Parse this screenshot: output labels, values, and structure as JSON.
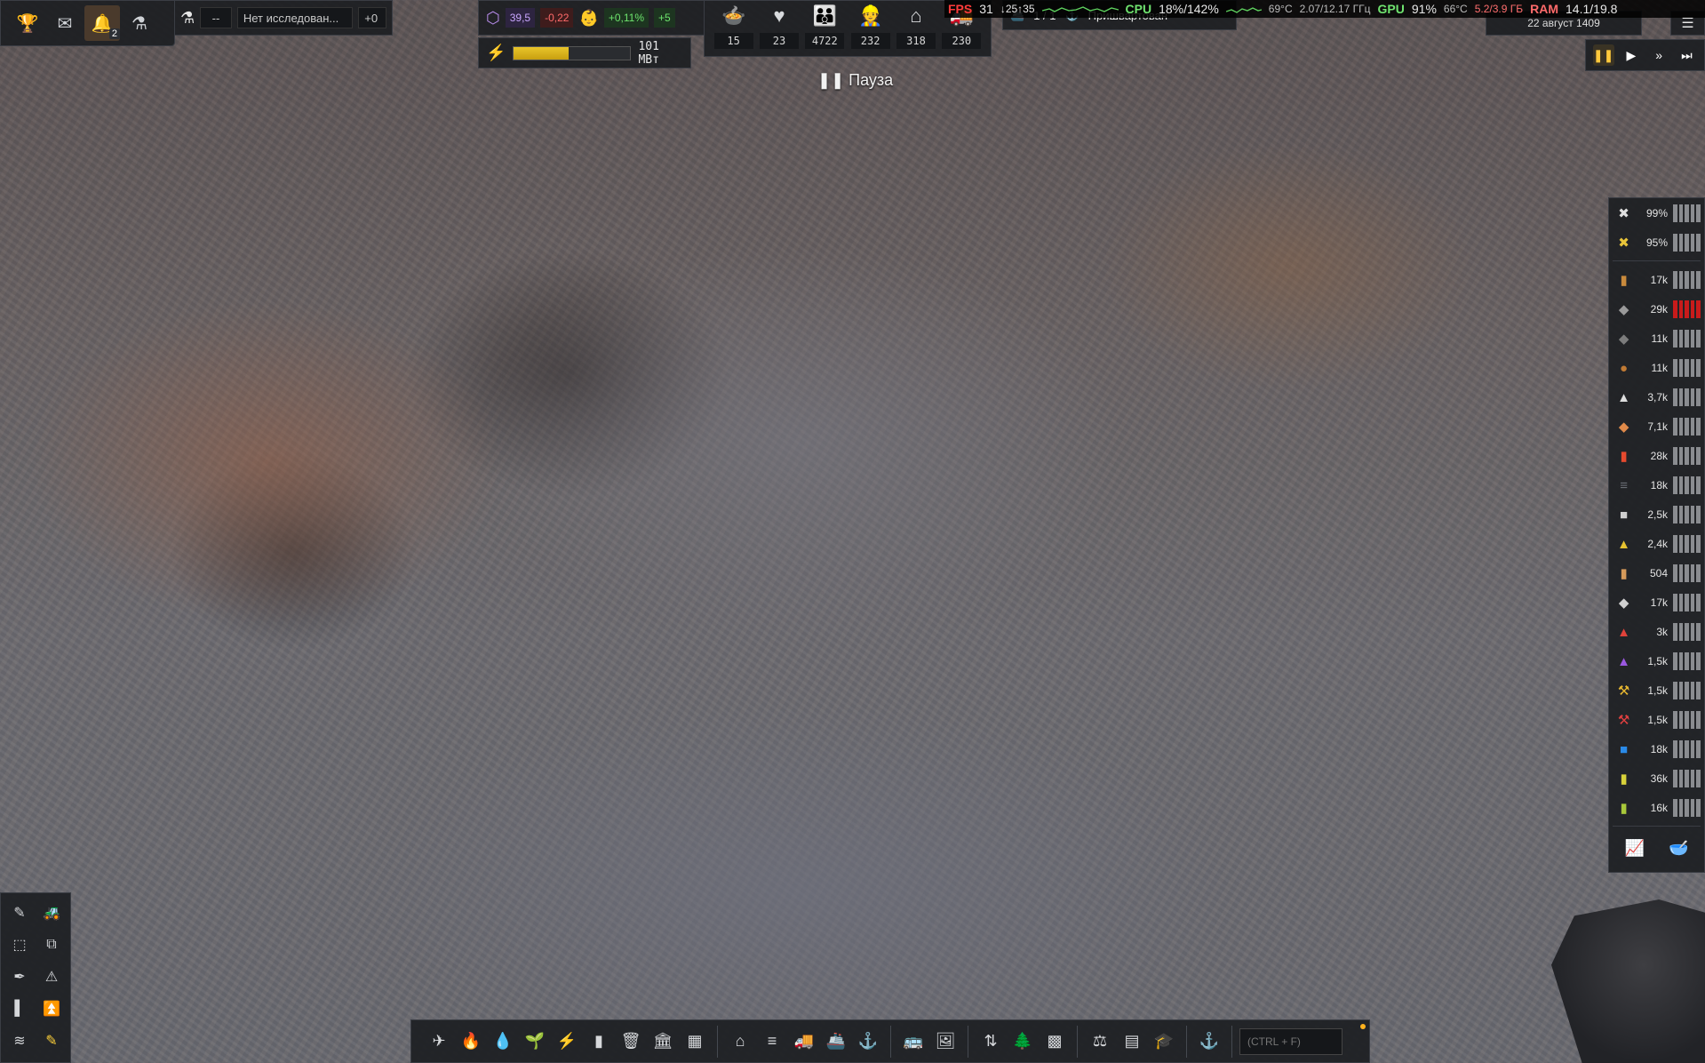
{
  "top_left": {
    "buttons": [
      {
        "name": "trophy-icon",
        "glyph": "🏆"
      },
      {
        "name": "mail-icon",
        "glyph": "✉"
      },
      {
        "name": "bell-icon",
        "glyph": "🔔",
        "badge": "2"
      },
      {
        "name": "flask-icon",
        "glyph": "⚗"
      }
    ],
    "research": {
      "timer": "--",
      "label": "Нет исследован...",
      "bonus": "+0"
    }
  },
  "economy": {
    "unity": "39,5",
    "unity_delta": "-0,22",
    "growth": "+0,11%",
    "growth_delta": "+5"
  },
  "power": {
    "value": "101 МВт",
    "fill": 0.47
  },
  "population": [
    {
      "icon": "food-icon",
      "glyph": "🍲",
      "value": "15"
    },
    {
      "icon": "health-icon",
      "glyph": "♥",
      "value": "23"
    },
    {
      "icon": "people-icon",
      "glyph": "👪",
      "value": "4722"
    },
    {
      "icon": "workers-icon",
      "glyph": "👷",
      "value": "232"
    },
    {
      "icon": "housing-icon",
      "glyph": "⌂",
      "value": "318"
    },
    {
      "icon": "vehicles-icon",
      "glyph": "🚚",
      "value": "230"
    }
  ],
  "pause_label": "Пауза",
  "ship": {
    "cargo": "1 / 1",
    "status": "Пришвартован"
  },
  "perf": {
    "fps_label": "FPS",
    "fps": "31",
    "fps_minmax": "↓25↑35",
    "cpu_label": "CPU",
    "cpu": "18%/142%",
    "cpu_temp": "69°C",
    "cpu_clock": "2.07/12.17 ГГц",
    "gpu_label": "GPU",
    "gpu": "91%",
    "gpu_temp": "66°C",
    "gpu_mem": "5.2/3.9 ГБ",
    "ram_label": "RAM",
    "ram": "14.1/19.8"
  },
  "date": "22 август 1409",
  "speed": [
    {
      "name": "pause-speed-button",
      "glyph": "❚❚",
      "on": true
    },
    {
      "name": "play-speed-button",
      "glyph": "▶",
      "on": false
    },
    {
      "name": "fast-speed-button",
      "glyph": "»",
      "on": false
    },
    {
      "name": "fastest-speed-button",
      "glyph": "⏭",
      "on": false
    }
  ],
  "resources": [
    {
      "name": "maintenance-1",
      "glyph": "✖",
      "color": "#e0e0e0",
      "value": "99%",
      "red": false
    },
    {
      "name": "maintenance-2",
      "glyph": "✖",
      "color": "#e8c43a",
      "value": "95%",
      "red": false
    },
    {
      "name": "wood",
      "glyph": "▮",
      "color": "#c98a3c",
      "value": "17k",
      "red": false
    },
    {
      "name": "coal-ore",
      "glyph": "◆",
      "color": "#9a9a9a",
      "value": "29k",
      "red": true
    },
    {
      "name": "stone",
      "glyph": "◆",
      "color": "#7c7c7c",
      "value": "11k",
      "red": false
    },
    {
      "name": "rock",
      "glyph": "●",
      "color": "#c07a34",
      "value": "11k",
      "red": false
    },
    {
      "name": "construction-parts",
      "glyph": "▲",
      "color": "#dedede",
      "value": "3,7k",
      "red": false
    },
    {
      "name": "bricks",
      "glyph": "◆",
      "color": "#e08a4a",
      "value": "7,1k",
      "red": false
    },
    {
      "name": "fuel",
      "glyph": "▮",
      "color": "#e64a2e",
      "value": "28k",
      "red": false
    },
    {
      "name": "iron",
      "glyph": "≡",
      "color": "#6a6e74",
      "value": "18k",
      "red": false
    },
    {
      "name": "concrete",
      "glyph": "■",
      "color": "#cfcfcf",
      "value": "2,5k",
      "red": false
    },
    {
      "name": "gold-parts",
      "glyph": "▲",
      "color": "#e6c230",
      "value": "2,4k",
      "red": false
    },
    {
      "name": "food-box",
      "glyph": "▮",
      "color": "#d59a5a",
      "value": "504",
      "red": false
    },
    {
      "name": "steel",
      "glyph": "◆",
      "color": "#d0d0d0",
      "value": "17k",
      "red": false
    },
    {
      "name": "red-parts",
      "glyph": "▲",
      "color": "#e0423a",
      "value": "3k",
      "red": false
    },
    {
      "name": "purple-parts",
      "glyph": "▲",
      "color": "#9a58e0",
      "value": "1,5k",
      "red": false
    },
    {
      "name": "yellow-tool",
      "glyph": "⚒",
      "color": "#e8b830",
      "value": "1,5k",
      "red": false
    },
    {
      "name": "red-tool",
      "glyph": "⚒",
      "color": "#e04040",
      "value": "1,5k",
      "red": false
    },
    {
      "name": "water",
      "glyph": "■",
      "color": "#2a8ae8",
      "value": "18k",
      "red": false
    },
    {
      "name": "battery",
      "glyph": "▮",
      "color": "#d8d23a",
      "value": "36k",
      "red": false
    },
    {
      "name": "chemicals",
      "glyph": "▮",
      "color": "#a8c83a",
      "value": "16k",
      "red": false
    }
  ],
  "bottom": {
    "groups": [
      [
        "✈",
        "🔥",
        "💧",
        "🌱",
        "⚡",
        "▮",
        "🗑",
        "🏛",
        "▦"
      ],
      [
        "⌂",
        "≡",
        "🚚",
        "🚢",
        "⚓"
      ],
      [
        "🚌",
        "🖼"
      ],
      [
        "⇅",
        "🌲",
        "▩"
      ],
      [
        "⚖",
        "▤",
        "🎓"
      ],
      [
        "⚓"
      ]
    ],
    "search_placeholder": "(CTRL + F)"
  }
}
